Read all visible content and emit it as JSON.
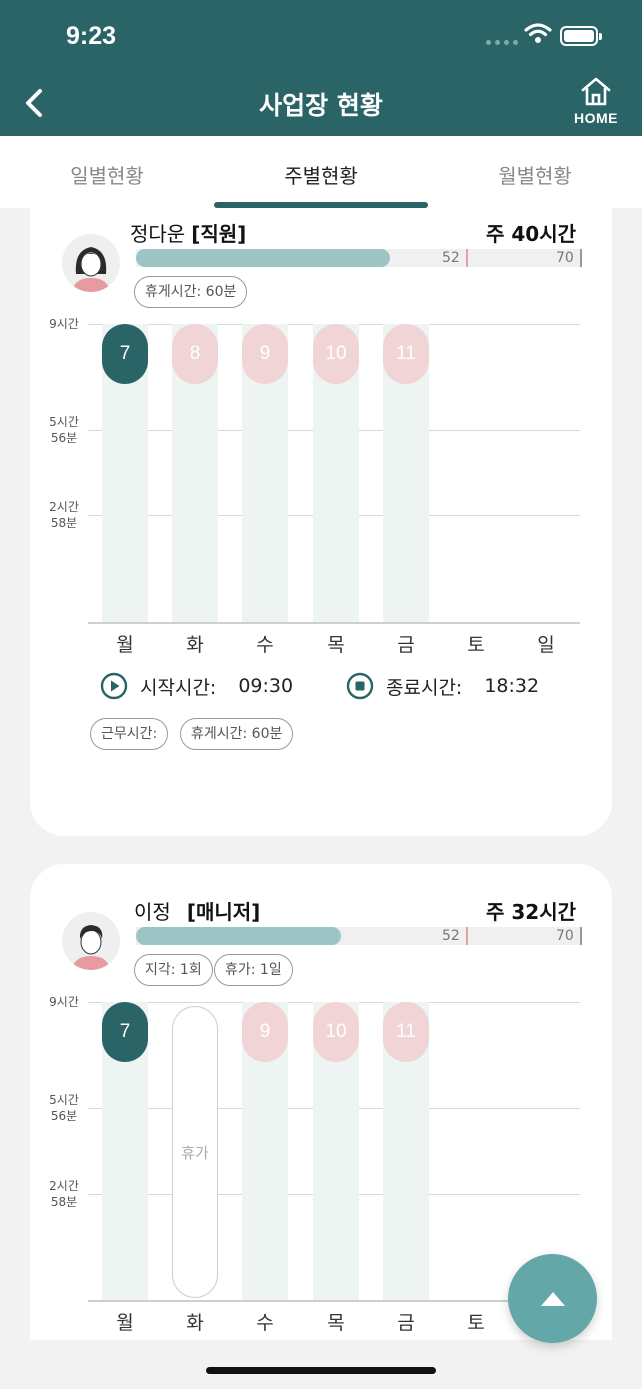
{
  "status": {
    "time": "9:23"
  },
  "header": {
    "title": "사업장 현황",
    "home_label": "HOME"
  },
  "tabs": [
    {
      "label": "일별현황",
      "active": false
    },
    {
      "label": "주별현황",
      "active": true
    },
    {
      "label": "월별현황",
      "active": false
    }
  ],
  "chart_axis": {
    "y_labels": [
      {
        "line1": "9시간",
        "line2": ""
      },
      {
        "line1": "5시간",
        "line2": "56분"
      },
      {
        "line1": "2시간",
        "line2": "58분"
      }
    ],
    "days": [
      "월",
      "화",
      "수",
      "목",
      "금",
      "토",
      "일"
    ]
  },
  "employees": [
    {
      "name": "정다운",
      "role": "[직원]",
      "week_total": "주 40시간",
      "progress": {
        "fill_fraction": 0.57,
        "mark1": "52",
        "mark2": "70"
      },
      "tags": [
        "휴게시간: 60분"
      ],
      "dates": [
        "7",
        "8",
        "9",
        "10",
        "11"
      ],
      "start_label": "시작시간:",
      "start_time": "09:30",
      "end_label": "종료시간:",
      "end_time": "18:32",
      "bottom_tags": [
        "근무시간:",
        "휴게시간: 60분"
      ]
    },
    {
      "name": "이정",
      "role": "[매니저]",
      "week_total": "주 32시간",
      "progress": {
        "fill_fraction": 0.46,
        "mark1": "52",
        "mark2": "70"
      },
      "tags": [
        "지각: 1회",
        "휴가: 1일"
      ],
      "dates": [
        "7",
        "9",
        "10",
        "11"
      ],
      "vacation_label": "휴가"
    }
  ],
  "colors": {
    "primary": "#2a6466",
    "date_today": "#2a6466",
    "date_other": "#f1d4d6",
    "progress": "#9cc4c4",
    "fab": "#64a7a8"
  },
  "icons": {
    "back": "chevron-left-icon",
    "home": "home-icon",
    "play": "play-circle-icon",
    "stop": "stop-circle-icon",
    "scroll_top": "arrow-up-icon"
  }
}
